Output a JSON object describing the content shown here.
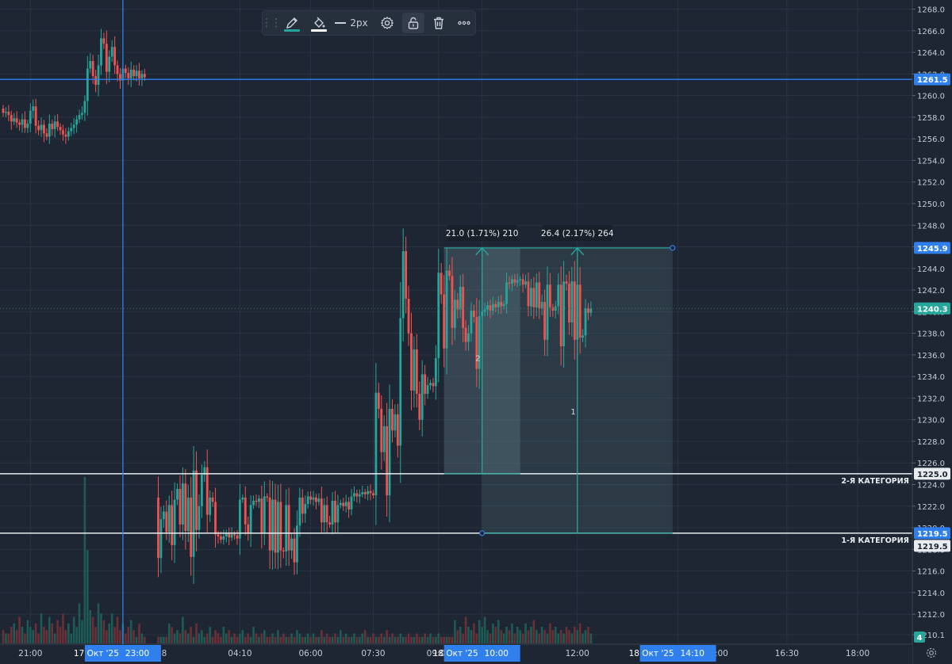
{
  "chart_data": {
    "type": "candlestick",
    "price_axis": {
      "min": 1209.15,
      "max": 1268.7,
      "ticks": [
        1210.1,
        1212.0,
        1214.0,
        1216.0,
        1218.0,
        1220.0,
        1222.0,
        1224.0,
        1226.0,
        1228.0,
        1230.0,
        1232.0,
        1234.0,
        1236.0,
        1238.0,
        1240.0,
        1242.0,
        1244.0,
        1246.0,
        1248.0,
        1250.0,
        1252.0,
        1254.0,
        1256.0,
        1258.0,
        1260.0,
        1262.0,
        1264.0,
        1266.0,
        1268.0
      ]
    },
    "time_axis": {
      "ticks": [
        {
          "label": "21:00",
          "slot": 10
        },
        {
          "label": "04:10",
          "slot": 87
        },
        {
          "label": "06:00",
          "slot": 113
        },
        {
          "label": "07:30",
          "slot": 136
        },
        {
          "label": "09:00",
          "slot": 160
        },
        {
          "label": "12:00",
          "slot": 211
        },
        {
          "label": "16:30",
          "slot": 288
        },
        {
          "label": "18:00",
          "slot": 314
        }
      ],
      "highlights": [
        {
          "label": "17 Окт '25",
          "time": "23:00",
          "slot": 44
        },
        {
          "label": "18 Окт '25",
          "time": "10:00",
          "slot": 176
        },
        {
          "label": "18 Окт '25",
          "time": "14:10",
          "slot": 248
        }
      ],
      "tail_label": "5:00",
      "tail_slot": 263
    },
    "segments": [
      {
        "start": 0,
        "open": 1258.8,
        "pts": [
          1258.4,
          1258.5,
          1258.2,
          1257.6,
          1257.9,
          1257.5,
          1257.3,
          1257.8,
          1257.0,
          1257.4,
          1258.6,
          1259.0,
          1257.2,
          1256.8,
          1257.3,
          1256.5,
          1256.2,
          1257.4,
          1256.9,
          1257.6,
          1257.1,
          1256.8,
          1256.4,
          1256.2,
          1256.7,
          1257.0,
          1257.3,
          1257.8,
          1258.2,
          1258.4,
          1259.5,
          1262.5,
          1263.2,
          1261.8,
          1261.0,
          1262.8,
          1265.3,
          1264.8,
          1262.2,
          1263.6,
          1264.5,
          1262.8,
          1262.0,
          1261.4,
          1262.5,
          1262.1,
          1261.6,
          1262.4,
          1261.8,
          1262.3,
          1261.6,
          1262.0,
          1261.7
        ]
      },
      {
        "start": 57,
        "open": 1222.8,
        "pts": [
          1217.2,
          1220.8,
          1221.5,
          1219.6,
          1222.1,
          1218.4,
          1222.6,
          1223.6,
          1220.3,
          1224.1,
          1219.7,
          1222.8,
          1217.3,
          1225.3,
          1219.8,
          1222.0,
          1224.9,
          1225.6,
          1221.2,
          1222.8,
          1222.4,
          1219.4,
          1219.2,
          1218.9,
          1219.2,
          1219.5,
          1219.1,
          1219.4,
          1219.3,
          1219.0,
          1222.6,
          1222.8,
          1220.3,
          1219.5,
          1222.1,
          1222.5,
          1222.4,
          1222.7,
          1219.5,
          1222.9,
          1222.8,
          1217.9,
          1222.6,
          1217.7,
          1222.4,
          1217.9,
          1217.8,
          1222.1,
          1217.9,
          1219.0,
          1216.8,
          1220.2,
          1222.8,
          1221.3,
          1222.2,
          1222.9,
          1222.6,
          1222.8,
          1222.4,
          1222.7,
          1220.5,
          1222.1,
          1220.5,
          1220.3,
          1222.5,
          1220.5,
          1222.1,
          1222.3,
          1222.0,
          1222.4,
          1221.7,
          1222.9,
          1223.2,
          1222.9,
          1223.1,
          1223.3,
          1223.1,
          1223.4,
          1223.2,
          1223.0,
          1232.5,
          1231.0,
          1227.0,
          1229.4,
          1223.0,
          1231.0,
          1229.0,
          1230.5,
          1227.6,
          1239.4,
          1245.6,
          1241.2,
          1238.0,
          1232.7,
          1236.5,
          1232.4,
          1230.0,
          1234.2,
          1232.4,
          1233.2,
          1233.4,
          1233.1,
          1235.7,
          1243.6,
          1241.6,
          1236.6,
          1243.8,
          1243.3,
          1238.5,
          1241.1,
          1240.2,
          1242.3,
          1238.5,
          1237.2,
          1238.0,
          1240.1,
          1239.5,
          1234.7,
          1239.6,
          1240.0,
          1240.2,
          1240.6,
          1240.1,
          1240.7,
          1240.4,
          1240.9,
          1240.5,
          1240.7,
          1242.7,
          1242.6,
          1243.0,
          1242.7,
          1242.9,
          1243.0,
          1242.5,
          1242.8,
          1240.5,
          1242.2,
          1240.4,
          1242.7,
          1240.3,
          1240.9,
          1237.4,
          1242.5,
          1240.4,
          1240.1,
          1240.5,
          1242.5,
          1236.8,
          1242.8,
          1242.6,
          1239.0,
          1242.8,
          1237.4,
          1242.5,
          1237.6,
          1237.8,
          1240.3,
          1239.9,
          1240.3
        ]
      }
    ],
    "volumes": [
      4,
      3,
      3,
      5,
      6,
      4,
      8,
      5,
      3,
      7,
      5,
      4,
      6,
      3,
      9,
      5,
      4,
      8,
      6,
      3,
      7,
      5,
      9,
      4,
      6,
      3,
      8,
      5,
      12,
      7,
      50,
      28,
      10,
      8,
      5,
      12,
      9,
      7,
      4,
      6,
      9,
      5,
      8,
      4,
      6,
      3,
      5,
      7,
      4,
      2,
      6,
      3,
      2,
      2,
      2,
      2,
      2,
      6,
      5,
      3,
      4,
      3,
      8,
      4,
      3,
      5,
      2,
      6,
      3,
      4,
      2,
      3,
      5,
      2,
      4,
      3,
      2,
      5,
      3,
      4,
      2,
      3,
      2,
      3,
      4,
      2,
      3,
      2,
      5,
      3,
      2,
      3,
      4,
      2,
      2,
      3,
      2,
      4,
      2,
      3,
      2,
      2,
      3,
      2,
      4,
      3,
      2,
      2,
      3,
      2,
      3,
      2,
      2,
      4,
      2,
      3,
      2,
      2,
      3,
      2,
      4,
      2,
      3,
      2,
      2,
      3,
      2,
      2,
      3,
      4,
      2,
      2,
      3,
      2,
      2,
      3,
      2,
      4,
      2,
      3,
      2,
      2,
      3,
      2,
      2,
      3,
      2,
      2,
      3,
      2,
      2,
      3,
      2,
      3,
      2,
      2,
      3,
      2,
      2,
      2,
      2,
      2,
      7,
      4,
      5,
      3,
      8,
      5,
      4,
      6,
      3,
      7,
      5,
      8,
      4,
      3,
      6,
      5,
      7,
      4,
      3,
      5,
      4,
      6,
      3,
      5,
      4,
      3,
      6,
      4,
      5,
      7,
      4,
      3,
      5,
      4,
      3,
      6,
      4,
      5,
      3,
      4,
      3,
      5,
      4,
      3,
      5,
      4,
      6,
      3,
      4,
      5,
      3,
      4,
      6,
      4,
      5,
      3,
      4,
      3,
      5,
      4,
      3,
      4,
      3,
      5,
      4,
      6,
      3,
      4,
      5,
      3,
      4,
      3,
      2,
      3,
      2
    ],
    "horizontal_lines": [
      {
        "price": 1261.5,
        "badge": "1261.5",
        "color": "#2f80ed"
      },
      {
        "price": 1225.0,
        "badge": "1225.0",
        "color": "#e8ecf1",
        "label": "2-Я КАТЕГОРИЯ"
      },
      {
        "price": 1219.5,
        "badge": "1219.5",
        "color": "#e8ecf1",
        "label": "1-Я КАТЕГОРИЯ"
      }
    ],
    "last_price": {
      "price": 1240.3,
      "badge": "1240.3"
    },
    "price_badges": [
      {
        "price": 1245.9,
        "label": "1245.9"
      },
      {
        "price": 1219.5,
        "label": "1219.5"
      }
    ],
    "crosshair": {
      "slot": 44
    },
    "measurements": [
      {
        "label": "21.0 (1.71%) 210",
        "number": "2",
        "from_slot": 162,
        "to_slot": 176,
        "to2_slot": 190,
        "low": 1225.0,
        "high": 1245.9
      },
      {
        "label": "26.4 (2.17%) 264",
        "number": "1",
        "from_slot": 176,
        "to_slot": 211,
        "to2_slot": 246,
        "low": 1219.5,
        "high": 1245.9
      }
    ],
    "volume_badge": "4"
  },
  "toolbar": {
    "width_label": "2px",
    "icons": [
      "drag-handle-icon",
      "pencil-icon",
      "paint-bucket-icon",
      "line-width-icon",
      "gear-icon",
      "lock-icon",
      "trash-icon",
      "more-icon"
    ],
    "pencil_color": "#26a69a",
    "bucket_color": "#ffffff"
  },
  "colors": {
    "background": "#1e2633",
    "grid": "#2a3341",
    "bull": "#26a69a",
    "bear": "#ef5350",
    "axis_text": "#c5cbd3",
    "accent": "#2f80ed"
  }
}
